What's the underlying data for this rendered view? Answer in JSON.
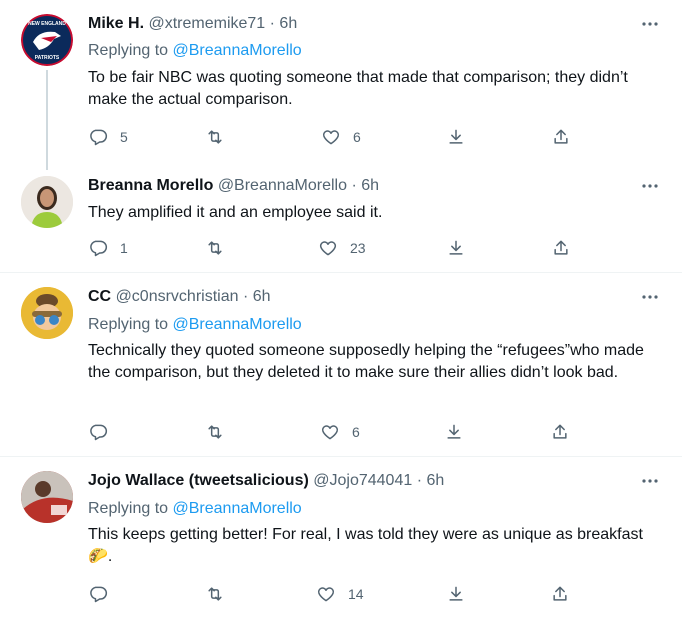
{
  "tweets": [
    {
      "name": "Mike H.",
      "handle": "@xtrememike71",
      "sep": "·",
      "time": "6h",
      "replying_prefix": "Replying to",
      "replying_to": "@BreannaMorello",
      "text": "To be fair NBC was quoting someone that made that comparison; they didn’t make the actual comparison.",
      "replies": "5",
      "retweets": "",
      "likes": "6"
    },
    {
      "name": "Breanna Morello",
      "handle": "@BreannaMorello",
      "sep": "·",
      "time": "6h",
      "text": "They amplified it and an employee said it.",
      "replies": "1",
      "retweets": "",
      "likes": "23"
    },
    {
      "name": "CC",
      "handle": "@c0nsrvchristian",
      "sep": "·",
      "time": "6h",
      "replying_prefix": "Replying to",
      "replying_to": "@BreannaMorello",
      "text": "Technically they quoted someone supposedly helping the “refugees”who made the comparison, but they deleted it to make sure their allies didn’t look bad.",
      "replies": "",
      "retweets": "",
      "likes": "6"
    },
    {
      "name": "Jojo Wallace (tweetsalicious)",
      "handle": "@Jojo744041",
      "sep": "·",
      "time": "6h",
      "replying_prefix": "Replying to",
      "replying_to": "@BreannaMorello",
      "text": "This keeps getting better! For real, I was told they were as unique as breakfast 🌮.",
      "replies": "",
      "retweets": "",
      "likes": "14"
    }
  ],
  "avatar_logo_text": {
    "top": "NEW ENGLAND",
    "bottom": "PATRIOTS"
  },
  "colors": {
    "accent": "#1d9bf0",
    "muted": "#536471",
    "text": "#0f1419",
    "divider": "#eff3f4",
    "thread": "#cfd9de"
  }
}
